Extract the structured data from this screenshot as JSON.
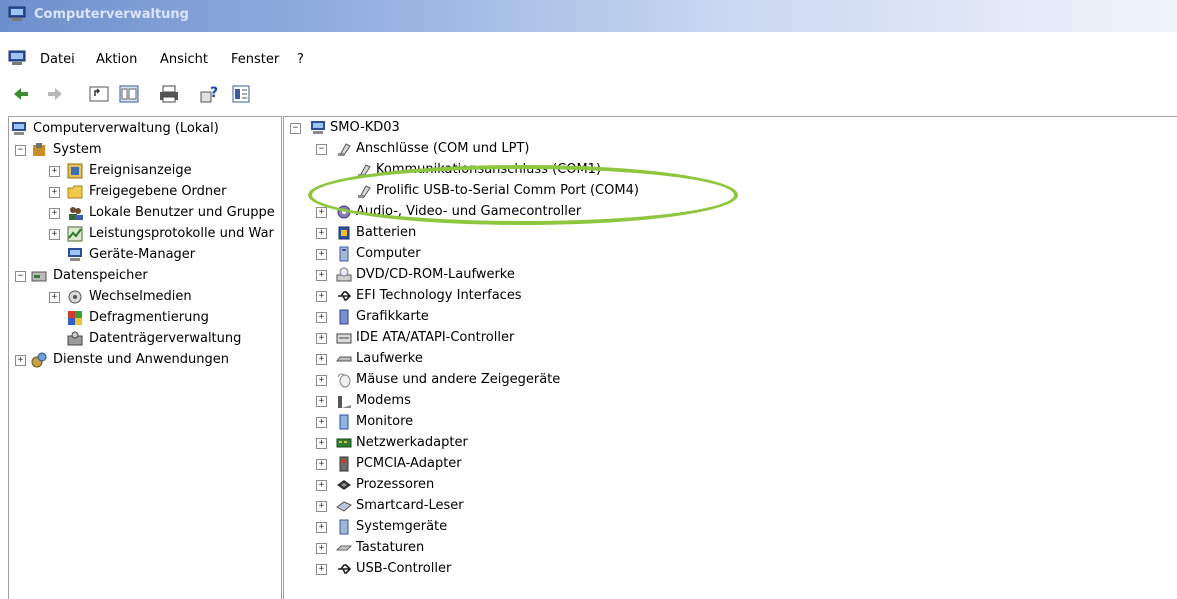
{
  "window": {
    "title": "Computerverwaltung"
  },
  "menu": [
    "Datei",
    "Aktion",
    "Ansicht",
    "Fenster",
    "?"
  ],
  "toolbar": [
    "back-icon",
    "forward-icon",
    "up-folder-icon",
    "show-hide-tree-icon",
    "print-icon",
    "help-icon",
    "properties-icon"
  ],
  "left_tree": [
    {
      "label": "Computerverwaltung (Lokal)",
      "icon": "computer-icon"
    },
    {
      "label": "System",
      "icon": "system-tools-icon"
    },
    {
      "label": "Ereignisanzeige",
      "icon": "event-viewer-icon"
    },
    {
      "label": "Freigegebene Ordner",
      "icon": "shared-folders-icon"
    },
    {
      "label": "Lokale Benutzer und Gruppe",
      "icon": "users-icon"
    },
    {
      "label": "Leistungsprotokolle und War",
      "icon": "performance-icon"
    },
    {
      "label": "Geräte-Manager",
      "icon": "device-manager-icon"
    },
    {
      "label": "Datenspeicher",
      "icon": "storage-icon"
    },
    {
      "label": "Wechselmedien",
      "icon": "removable-media-icon"
    },
    {
      "label": "Defragmentierung",
      "icon": "defrag-icon"
    },
    {
      "label": "Datenträgerverwaltung",
      "icon": "disk-management-icon"
    },
    {
      "label": "Dienste und Anwendungen",
      "icon": "services-icon"
    }
  ],
  "right_tree": [
    {
      "label": "SMO-KD03",
      "icon": "computer-icon"
    },
    {
      "label": "Anschlüsse (COM und LPT)",
      "icon": "port-icon"
    },
    {
      "label": "Kommunikationsanschluss (COM1)",
      "icon": "port-icon"
    },
    {
      "label": "Prolific USB-to-Serial Comm Port (COM4)",
      "icon": "port-icon"
    },
    {
      "label": "Audio-, Video- und Gamecontroller",
      "icon": "audio-icon"
    },
    {
      "label": "Batterien",
      "icon": "battery-icon"
    },
    {
      "label": "Computer",
      "icon": "computer-icon"
    },
    {
      "label": "DVD/CD-ROM-Laufwerke",
      "icon": "cdrom-icon"
    },
    {
      "label": "EFI Technology Interfaces",
      "icon": "usb-icon"
    },
    {
      "label": "Grafikkarte",
      "icon": "display-adapter-icon"
    },
    {
      "label": "IDE ATA/ATAPI-Controller",
      "icon": "ide-controller-icon"
    },
    {
      "label": "Laufwerke",
      "icon": "disk-drive-icon"
    },
    {
      "label": "Mäuse und andere Zeigegeräte",
      "icon": "mouse-icon"
    },
    {
      "label": "Modems",
      "icon": "modem-icon"
    },
    {
      "label": "Monitore",
      "icon": "monitor-icon"
    },
    {
      "label": "Netzwerkadapter",
      "icon": "network-adapter-icon"
    },
    {
      "label": "PCMCIA-Adapter",
      "icon": "pcmcia-icon"
    },
    {
      "label": "Prozessoren",
      "icon": "processor-icon"
    },
    {
      "label": "Smartcard-Leser",
      "icon": "smartcard-icon"
    },
    {
      "label": "Systemgeräte",
      "icon": "system-device-icon"
    },
    {
      "label": "Tastaturen",
      "icon": "keyboard-icon"
    },
    {
      "label": "USB-Controller",
      "icon": "usb-icon"
    }
  ],
  "colors": {
    "title_gradient_start": "#6d8fcc",
    "highlight": "#8dc63f",
    "pane_border": "#a0a0a0"
  }
}
